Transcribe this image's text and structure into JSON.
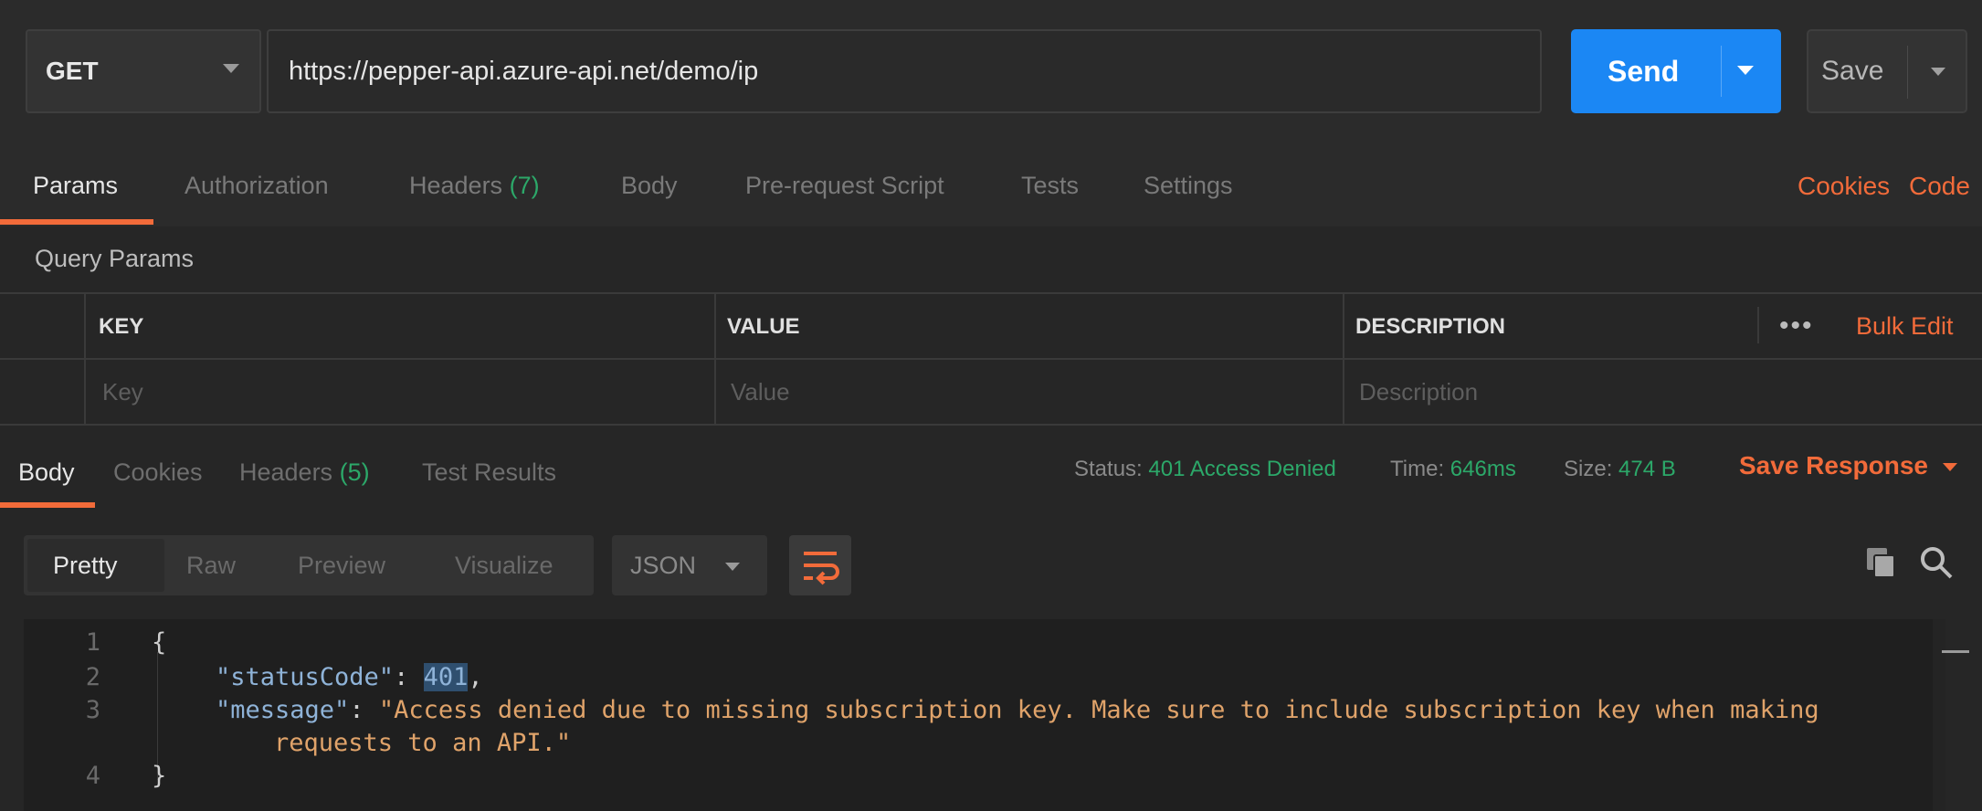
{
  "request": {
    "method": "GET",
    "url": "https://pepper-api.azure-api.net/demo/ip",
    "send_label": "Send",
    "save_label": "Save"
  },
  "request_tabs": [
    {
      "label": "Params",
      "active": true
    },
    {
      "label": "Authorization"
    },
    {
      "label": "Headers",
      "count": "(7)"
    },
    {
      "label": "Body"
    },
    {
      "label": "Pre-request Script"
    },
    {
      "label": "Tests"
    },
    {
      "label": "Settings"
    }
  ],
  "request_links": {
    "cookies": "Cookies",
    "code": "Code"
  },
  "query_params": {
    "label": "Query Params",
    "columns": [
      "KEY",
      "VALUE",
      "DESCRIPTION"
    ],
    "placeholders": {
      "key": "Key",
      "value": "Value",
      "description": "Description"
    },
    "more": "•••",
    "bulk_edit": "Bulk Edit"
  },
  "response_tabs": [
    {
      "label": "Body",
      "active": true
    },
    {
      "label": "Cookies"
    },
    {
      "label": "Headers",
      "count": "(5)"
    },
    {
      "label": "Test Results"
    }
  ],
  "response_meta": {
    "status_label": "Status:",
    "status_value": "401 Access Denied",
    "time_label": "Time:",
    "time_value": "646ms",
    "size_label": "Size:",
    "size_value": "474 B",
    "save_response": "Save Response"
  },
  "body_views": [
    "Pretty",
    "Raw",
    "Preview",
    "Visualize"
  ],
  "format": "JSON",
  "code": {
    "line_numbers": [
      "1",
      "2",
      "3",
      "",
      "4"
    ],
    "open_brace": "{",
    "close_brace": "}",
    "status_key": "\"statusCode\"",
    "status_value": "401",
    "message_key": "\"message\"",
    "message_value_1": "\"Access denied due to missing subscription key. Make sure to include subscription key when making",
    "message_value_2": "requests to an API.\""
  },
  "colors": {
    "accent": "#f26b3a",
    "primary": "#1b87f4",
    "success": "#2ca869",
    "background": "#262626"
  }
}
